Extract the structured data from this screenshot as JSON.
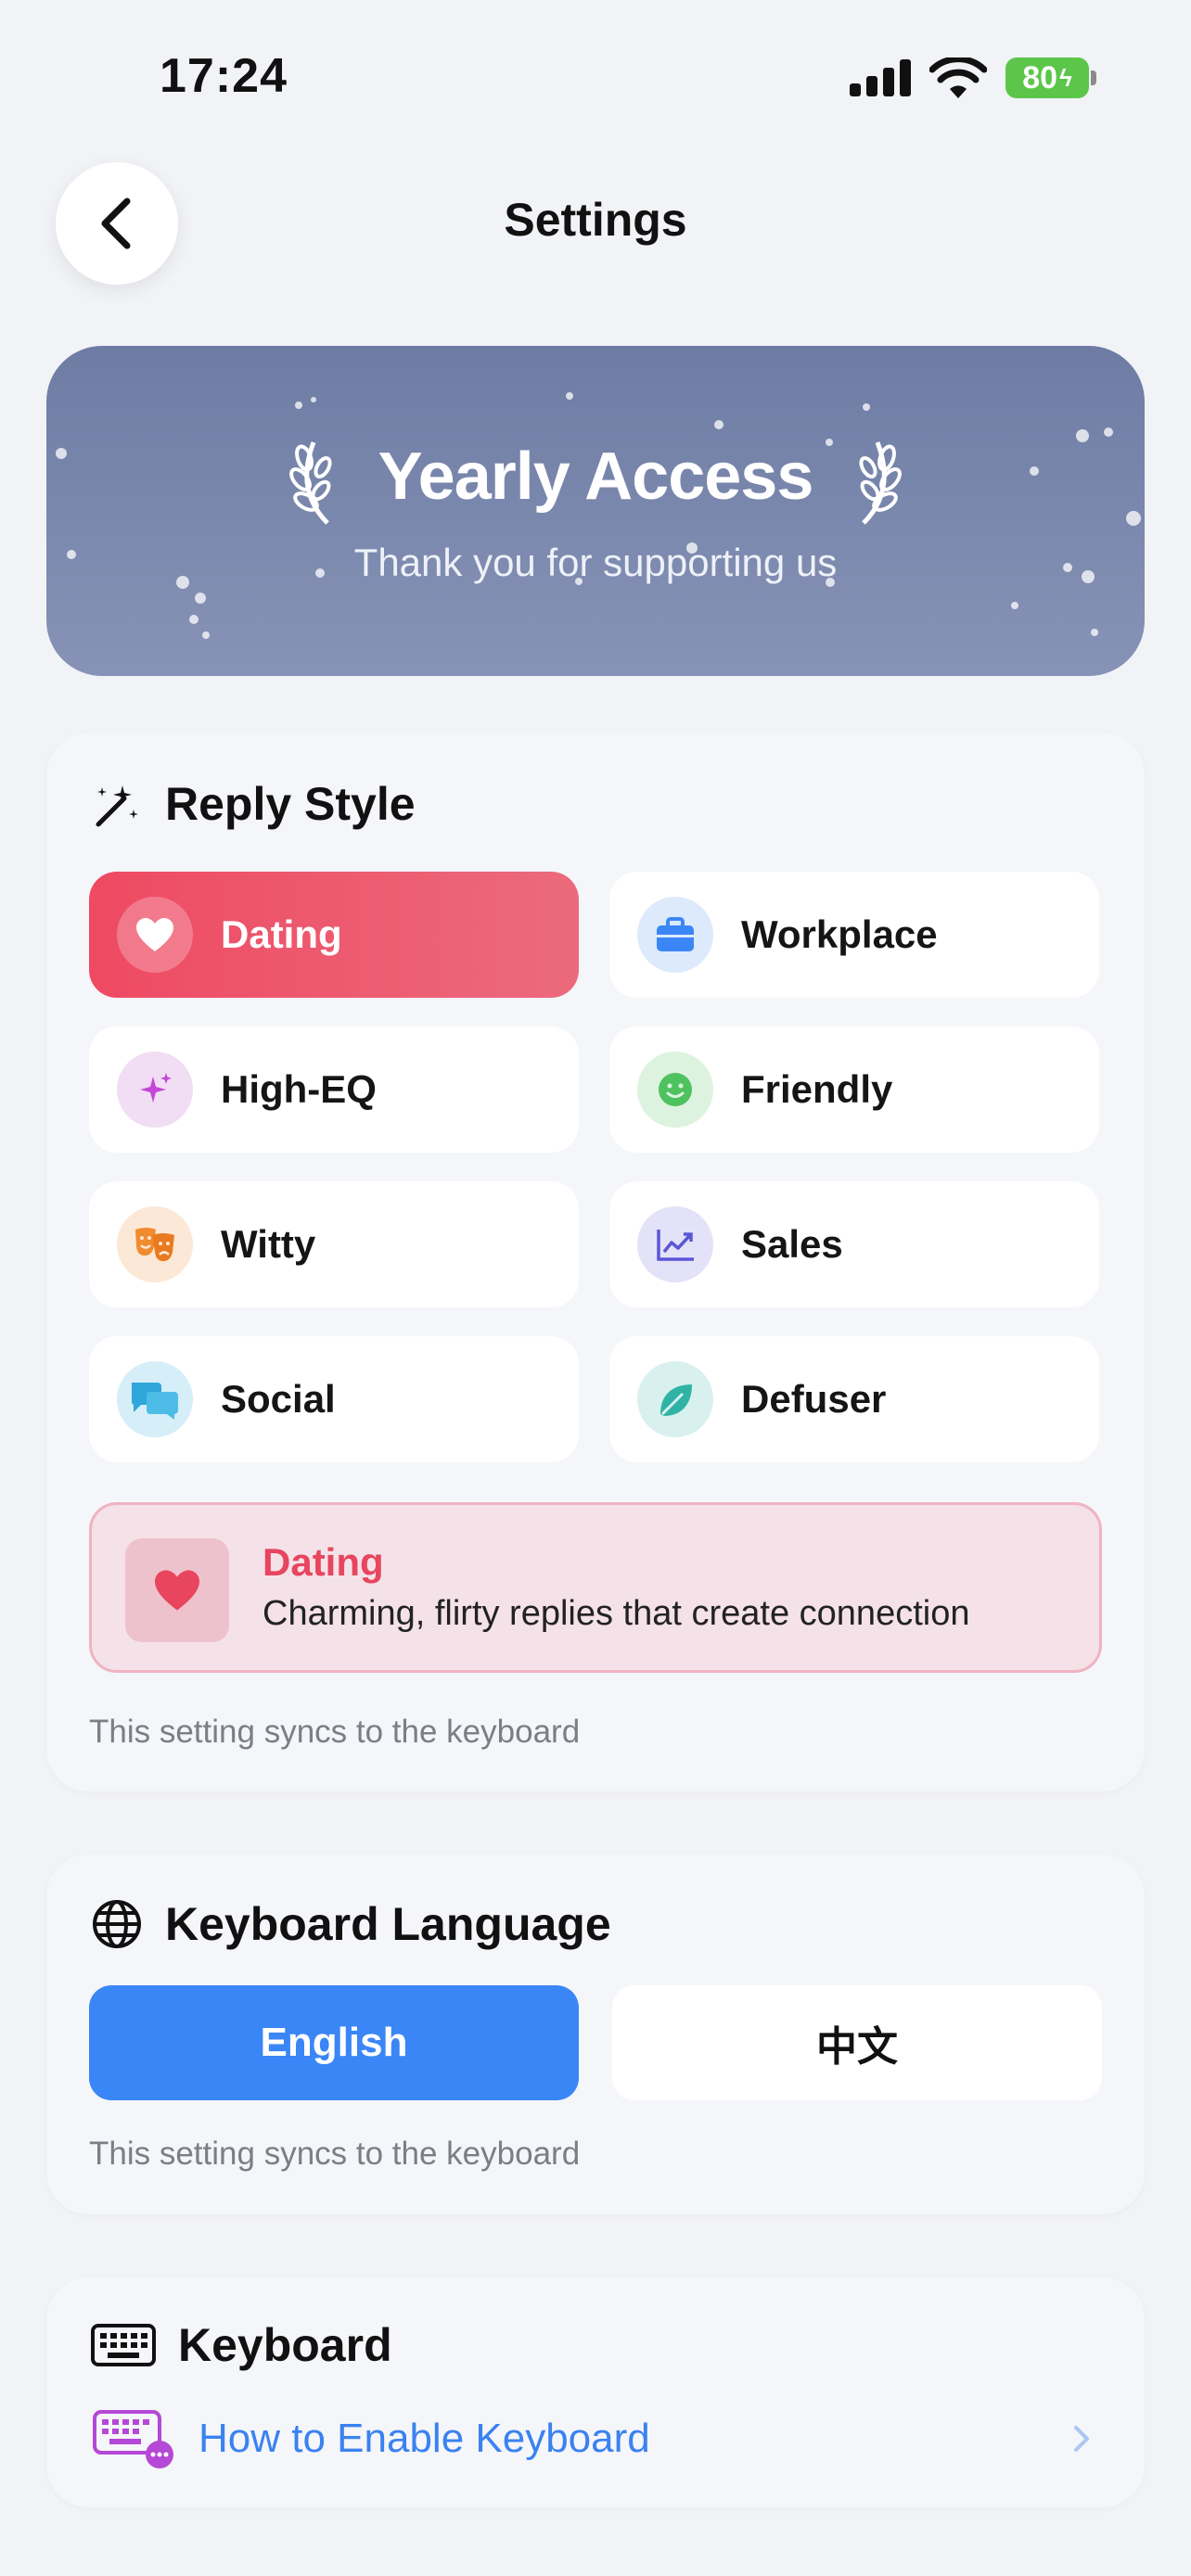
{
  "status_bar": {
    "time": "17:24",
    "battery": "80"
  },
  "nav": {
    "title": "Settings"
  },
  "banner": {
    "title": "Yearly Access",
    "subtitle": "Thank you for supporting us"
  },
  "reply_style": {
    "title": "Reply Style",
    "options": [
      {
        "label": "Dating",
        "icon": "heart-icon",
        "selected": true
      },
      {
        "label": "Workplace",
        "icon": "briefcase-icon",
        "selected": false
      },
      {
        "label": "High-EQ",
        "icon": "sparkles-icon",
        "selected": false
      },
      {
        "label": "Friendly",
        "icon": "smiley-icon",
        "selected": false
      },
      {
        "label": "Witty",
        "icon": "theater-masks-icon",
        "selected": false
      },
      {
        "label": "Sales",
        "icon": "trend-chart-icon",
        "selected": false
      },
      {
        "label": "Social",
        "icon": "chat-bubbles-icon",
        "selected": false
      },
      {
        "label": "Defuser",
        "icon": "leaf-icon",
        "selected": false
      }
    ],
    "detail": {
      "title": "Dating",
      "description": "Charming, flirty replies that create connection"
    },
    "note": "This setting syncs to the keyboard"
  },
  "keyboard_language": {
    "title": "Keyboard Language",
    "options": [
      {
        "label": "English",
        "selected": true
      },
      {
        "label": "中文",
        "selected": false
      }
    ],
    "note": "This setting syncs to the keyboard"
  },
  "keyboard": {
    "title": "Keyboard",
    "link": "How to Enable Keyboard"
  },
  "colors": {
    "accent_red": "#EE4A62",
    "accent_blue": "#3B86F6",
    "banner": "#7A86AC",
    "link": "#3A82F0"
  }
}
